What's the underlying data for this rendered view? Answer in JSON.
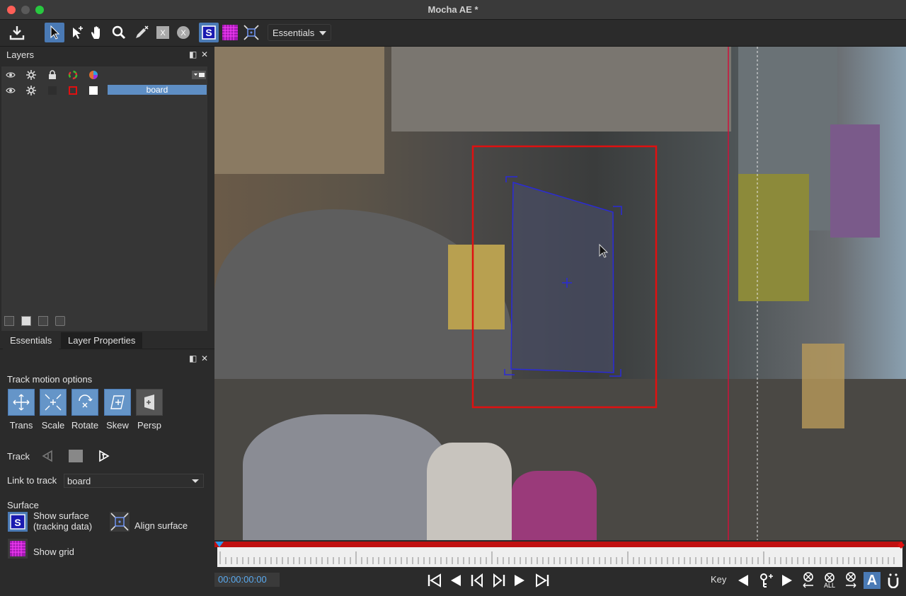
{
  "window": {
    "title": "Mocha AE *"
  },
  "toolbar": {
    "workspace_value": "Essentials",
    "tools": [
      "save-icon",
      "select-icon",
      "add-point-icon",
      "hand-icon",
      "zoom-icon",
      "pen-icon",
      "x-spline-icon",
      "b-spline-icon",
      "surface-icon",
      "grid-icon",
      "align-icon"
    ]
  },
  "layers_panel": {
    "title": "Layers",
    "layers": [
      {
        "name": "board"
      }
    ]
  },
  "tabs": {
    "essentials": "Essentials",
    "layer_properties": "Layer Properties"
  },
  "essentials": {
    "track_motion_title": "Track motion options",
    "motion": [
      {
        "label": "Trans",
        "active": true
      },
      {
        "label": "Scale",
        "active": true
      },
      {
        "label": "Rotate",
        "active": true
      },
      {
        "label": "Skew",
        "active": true
      },
      {
        "label": "Persp",
        "active": false
      }
    ],
    "track_label": "Track",
    "link_label": "Link to track",
    "link_value": "board",
    "surface_title": "Surface",
    "show_surface_line1": "Show surface",
    "show_surface_line2": "(tracking data)",
    "align_surface": "Align surface",
    "show_grid": "Show grid"
  },
  "transport": {
    "timecode": "00:00:00:00",
    "key_label": "Key",
    "all_label": "ALL",
    "auto_key_label": "A"
  },
  "colors": {
    "accent": "#4a7ab5",
    "layer_select": "#5e8ec4",
    "track_box": "#e01010",
    "surface": "#2a2ad8",
    "timecode": "#5aaaf0"
  }
}
